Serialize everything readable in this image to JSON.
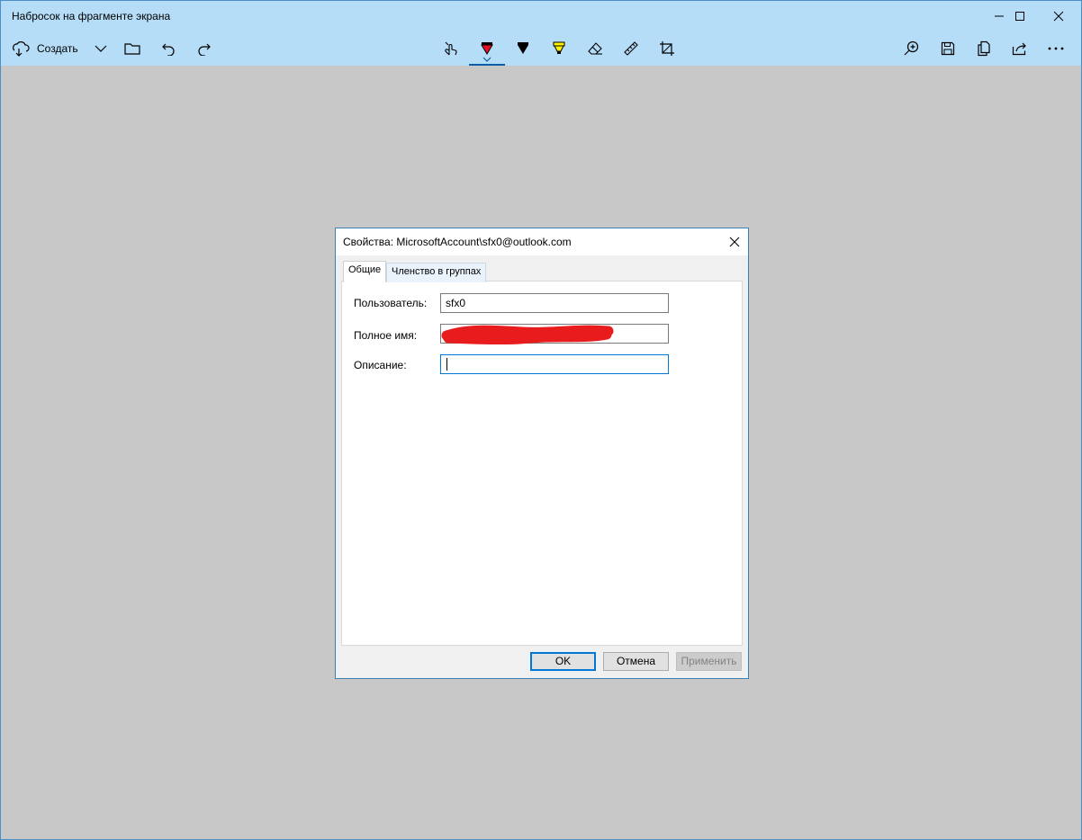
{
  "app": {
    "title": "Набросок на фрагменте экрана",
    "create_label": "Создать"
  },
  "toolbar": {
    "left": [
      "new-snip-icon",
      "chevron-down-icon",
      "folder-icon",
      "undo-icon",
      "redo-icon"
    ],
    "center": [
      "touch-writing-icon",
      "ballpoint-pen-icon",
      "pencil-icon",
      "highlighter-icon",
      "eraser-icon",
      "ruler-icon",
      "crop-icon"
    ],
    "right": [
      "zoom-in-icon",
      "save-icon",
      "copy-icon",
      "share-icon",
      "more-icon"
    ],
    "selected_tool": "ballpoint-pen-icon",
    "pen_colors": {
      "ballpoint": "#e81123",
      "pencil": "#000000",
      "highlighter": "#fff100"
    }
  },
  "colors": {
    "titlebar": "#b5ddf7",
    "canvas": "#c8c8c8",
    "accent": "#0078d7",
    "redaction": "#e81c1c"
  },
  "dialog": {
    "title": "Свойства: MicrosoftAccount\\sfx0@outlook.com",
    "tabs": [
      {
        "label": "Общие",
        "active": true
      },
      {
        "label": "Членство в группах",
        "active": false
      }
    ],
    "fields": {
      "user": {
        "label": "Пользователь:",
        "value": "sfx0"
      },
      "fullname": {
        "label": "Полное имя:",
        "value": ""
      },
      "description": {
        "label": "Описание:",
        "value": ""
      }
    },
    "buttons": {
      "ok": "OK",
      "cancel": "Отмена",
      "apply": "Применить"
    }
  }
}
